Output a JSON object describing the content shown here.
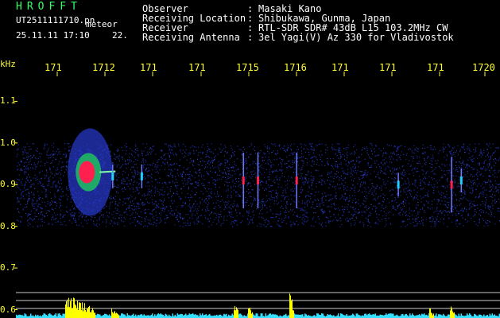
{
  "header": {
    "app_name": "HROFFT",
    "filename": "UT2511111710.pn",
    "tag": "meteor",
    "datetime": "25.11.11 17:10",
    "count": "22."
  },
  "meta": [
    {
      "key": "Observer",
      "value": "Masaki Kano"
    },
    {
      "key": "Receiving Location",
      "value": "Shibukawa, Gunma, Japan"
    },
    {
      "key": "Receiver",
      "value": "RTL-SDR SDR# 43dB L15 103.2MHz CW"
    },
    {
      "key": "Receiving Antenna",
      "value": "3el Yagi(V) Az 330 for Vladivostok"
    }
  ],
  "separator": ":",
  "colors": {
    "background": "#000000",
    "label_yellow": "#ffff33",
    "title_green": "#33ff66",
    "noise_blue": "#1a2a9a",
    "signal_red": "#ff2050",
    "signal_green": "#20c060",
    "level_yellow": "#ffff00",
    "level_cyan": "#33e0ff"
  },
  "chart_data": {
    "type": "heatmap",
    "title": "",
    "ylabel": "kHz",
    "x_tick_labels": [
      "171",
      "1712",
      "171",
      "171",
      "1715",
      "1716",
      "171",
      "171",
      "171",
      "1720"
    ],
    "y_tick_labels": [
      "1.1",
      "1.0",
      "0.9",
      "0.8",
      "0.7",
      "0.6"
    ],
    "y_ticks": [
      1.1,
      1.0,
      0.9,
      0.8,
      0.7,
      0.6
    ],
    "ylim": [
      0.58,
      1.16
    ],
    "noise_band": [
      0.8,
      1.0
    ],
    "echoes": [
      {
        "t": 0.14,
        "f": 0.93,
        "strength": "strong"
      },
      {
        "t": 0.2,
        "f": 0.92,
        "strength": "weak"
      },
      {
        "t": 0.26,
        "f": 0.92,
        "strength": "weak"
      },
      {
        "t": 0.47,
        "f": 0.91,
        "strength": "medium"
      },
      {
        "t": 0.5,
        "f": 0.91,
        "strength": "medium"
      },
      {
        "t": 0.58,
        "f": 0.91,
        "strength": "medium"
      },
      {
        "t": 0.79,
        "f": 0.9,
        "strength": "weak"
      },
      {
        "t": 0.9,
        "f": 0.9,
        "strength": "medium"
      },
      {
        "t": 0.92,
        "f": 0.91,
        "strength": "weak"
      }
    ]
  }
}
